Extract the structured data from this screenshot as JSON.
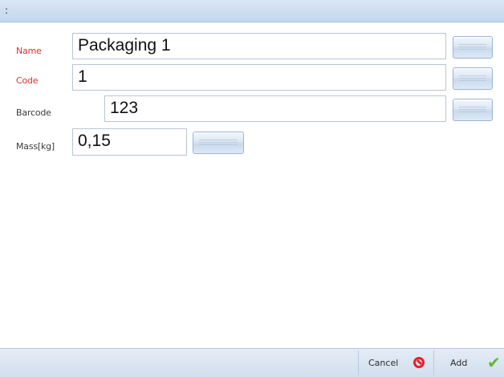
{
  "window": {
    "title": ":"
  },
  "form": {
    "name": {
      "label": "Name",
      "value": "Packaging 1",
      "required": true
    },
    "code": {
      "label": "Code",
      "value": "1",
      "required": true
    },
    "barcode": {
      "label": "Barcode",
      "value": "123",
      "required": false
    },
    "mass": {
      "label": "Mass[kg]",
      "value": "0,15",
      "required": false
    }
  },
  "toolbar": {
    "cancel_label": "Cancel",
    "add_label": "Add"
  },
  "colors": {
    "required_label": "#e0322b",
    "cancel_icon": "#e5212a",
    "add_icon": "#5fb63a"
  },
  "icons": {
    "keyboard": "keyboard-icon",
    "cancel": "no-entry-icon",
    "add": "checkmark-icon"
  }
}
